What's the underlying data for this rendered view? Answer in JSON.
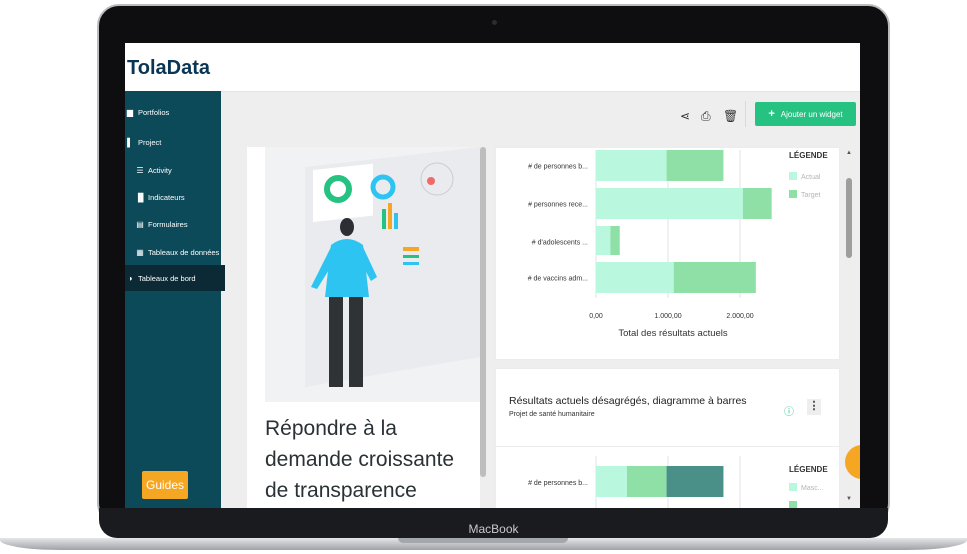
{
  "app": {
    "logo": "TolaData"
  },
  "sidebar": {
    "items": [
      {
        "label": "Portfolios",
        "icon": "briefcase-icon"
      },
      {
        "label": "Project",
        "icon": "folder-icon"
      },
      {
        "label": "Activity",
        "icon": "list-icon"
      },
      {
        "label": "Indicateurs",
        "icon": "bar-chart-icon"
      },
      {
        "label": "Formulaires",
        "icon": "form-icon"
      },
      {
        "label": "Tableaux de données",
        "icon": "table-icon"
      },
      {
        "label": "Tableaux de bord",
        "icon": "dashboard-icon",
        "active": true
      }
    ],
    "guides_label": "Guides"
  },
  "toolbar": {
    "add_widget_label": "Ajouter un widget"
  },
  "hero": {
    "line1": "Répondre à la",
    "line2": "demande croissante",
    "line3": "de transparence"
  },
  "chart1": {
    "legend_title": "LÉGENDE",
    "xlabel": "Total des résultats actuels"
  },
  "chart2": {
    "title": "Résultats actuels désagrégés, diagramme à barres",
    "subtitle": "Projet de santé humanitaire",
    "legend_title": "LÉGENDE"
  },
  "chart_data": [
    {
      "type": "bar",
      "orientation": "horizontal",
      "stacked": true,
      "categories": [
        "# de personnes b...",
        "# personnes rece...",
        "# d'adolescents ...",
        "# de vaccins adm..."
      ],
      "series": [
        {
          "name": "Actual",
          "color": "#b9f7de",
          "values": [
            980,
            2040,
            200,
            1080
          ]
        },
        {
          "name": "Target",
          "color": "#8fe0a6",
          "values": [
            790,
            400,
            130,
            1140
          ]
        }
      ],
      "xlim": [
        0,
        2500
      ],
      "xticks": [
        "0,00",
        "1.000,00",
        "2.000,00"
      ],
      "xlabel": "Total des résultats actuels",
      "grid": true,
      "legend": "top-right"
    },
    {
      "type": "bar",
      "orientation": "horizontal",
      "stacked": true,
      "categories": [
        "# de personnes b..."
      ],
      "series": [
        {
          "name": "Masc...",
          "color": "#b9f7de",
          "values": [
            430
          ]
        },
        {
          "name": "",
          "color": "#8fe0a6",
          "values": [
            550
          ]
        },
        {
          "name": "",
          "color": "#4a8f88",
          "values": [
            790
          ]
        }
      ],
      "xlim": [
        0,
        2500
      ],
      "legend": "top-right"
    }
  ],
  "macbook_label": "MacBook"
}
